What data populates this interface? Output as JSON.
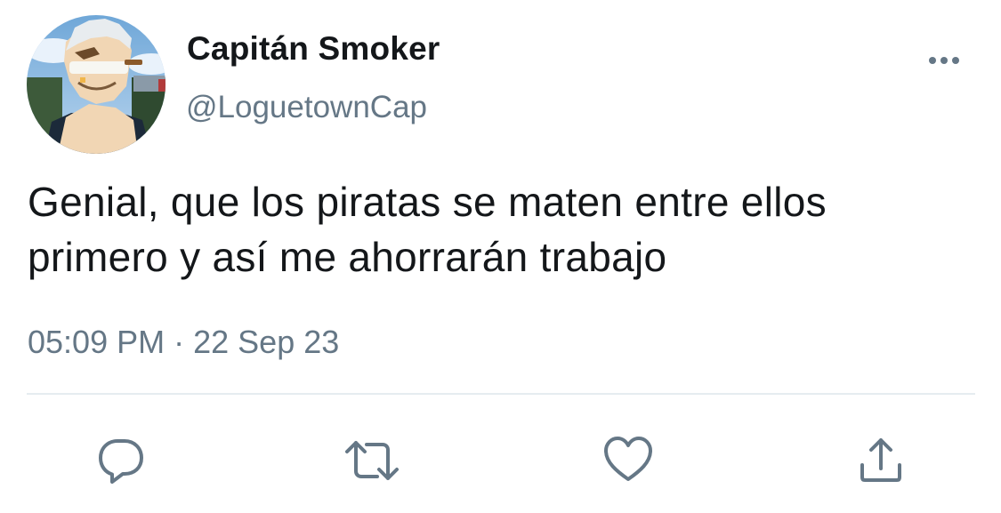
{
  "tweet": {
    "author": {
      "display_name": "Capitán Smoker",
      "handle": "@LoguetownCap"
    },
    "text_lines": [
      "Genial, que los piratas se maten entre ellos",
      "primero y así me ahorrarán trabajo"
    ],
    "time": "05:09 PM",
    "separator": "·",
    "date": "22 Sep 23"
  },
  "actions": {
    "reply_icon": "reply-icon",
    "retweet_icon": "retweet-icon",
    "like_icon": "heart-icon",
    "share_icon": "share-icon",
    "more_icon": "more-icon"
  },
  "colors": {
    "text_primary": "#14171a",
    "text_secondary": "#657786",
    "icon": "#657786",
    "divider": "#e6ecf0",
    "background": "#ffffff"
  }
}
